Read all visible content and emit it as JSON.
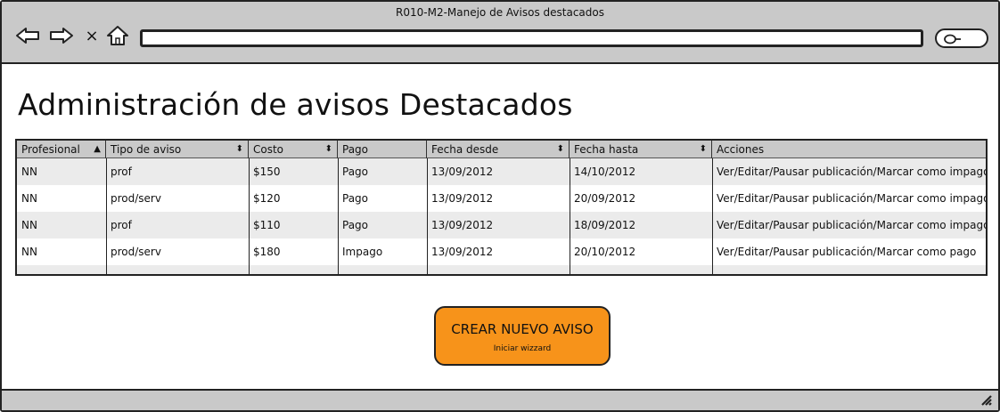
{
  "window": {
    "title": "R010-M2-Manejo de Avisos destacados"
  },
  "toolbar": {
    "back_icon": "arrow-left-icon",
    "forward_icon": "arrow-right-icon",
    "stop_label": "×",
    "home_icon": "home-icon",
    "url_value": "",
    "search_icon": "search-icon"
  },
  "page": {
    "title": "Administración de avisos Destacados"
  },
  "table": {
    "columns": [
      {
        "label": "Profesional",
        "sort": "▲"
      },
      {
        "label": "Tipo de aviso",
        "sort": "⬍"
      },
      {
        "label": "Costo",
        "sort": "⬍"
      },
      {
        "label": "Pago",
        "sort": ""
      },
      {
        "label": "Fecha desde",
        "sort": "⬍"
      },
      {
        "label": "Fecha hasta",
        "sort": "⬍"
      },
      {
        "label": "Acciones",
        "sort": ""
      }
    ],
    "rows": [
      [
        "NN",
        "prof",
        "$150",
        "Pago",
        "13/09/2012",
        "14/10/2012",
        "Ver/Editar/Pausar publicación/Marcar como impago"
      ],
      [
        "NN",
        "prod/serv",
        "$120",
        "Pago",
        "13/09/2012",
        "20/09/2012",
        "Ver/Editar/Pausar publicación/Marcar como impago"
      ],
      [
        "NN",
        "prof",
        "$110",
        "Pago",
        "13/09/2012",
        "18/09/2012",
        "Ver/Editar/Pausar publicación/Marcar como impago"
      ],
      [
        "NN",
        "prod/serv",
        "$180",
        "Impago",
        "13/09/2012",
        "20/10/2012",
        "Ver/Editar/Pausar publicación/Marcar como pago"
      ]
    ]
  },
  "cta": {
    "label": "CREAR NUEVO AVISO",
    "sublabel": "Iniciar wizzard",
    "color": "#f7931a"
  },
  "colors": {
    "chrome": "#c9c9c9",
    "row_alt": "#ebebeb",
    "border": "#222222"
  }
}
